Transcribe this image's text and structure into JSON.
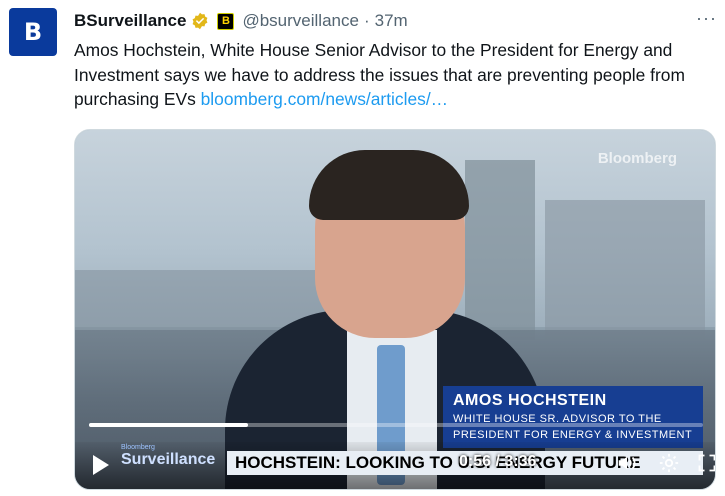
{
  "tweet": {
    "avatar_letter": "B",
    "display_name": "BSurveillance",
    "affiliate_badge": "B",
    "handle": "@bsurveillance",
    "separator": "·",
    "time": "37m",
    "more": "···",
    "text": "Amos Hochstein, White House Senior Advisor to the President for Energy and Investment says we have to address the issues that are preventing people from purchasing EVs ",
    "link_text": "bloomberg.com/news/articles/…"
  },
  "video": {
    "watermark": "Bloomberg",
    "lower_third_name": "AMOS HOCHSTEIN",
    "lower_third_title_1": "WHITE HOUSE SR. ADVISOR TO THE",
    "lower_third_title_2": "PRESIDENT FOR ENERGY & INVESTMENT",
    "brand_small": "Bloomberg",
    "brand_big": "Surveillance",
    "ticker": "HOCHSTEIN: LOOKING TO U.S. ENERGY FUTURE",
    "elapsed": "0:56",
    "duration": "3:36",
    "time_separator": " / ",
    "progress": 0.259
  },
  "colors": {
    "link": "#1d9bf0",
    "secondary_text": "#536471",
    "lower_third_bg": "#173e92"
  },
  "icons": [
    "verified-badge-icon",
    "play-icon",
    "volume-icon",
    "settings-icon",
    "fullscreen-icon",
    "more-icon"
  ]
}
